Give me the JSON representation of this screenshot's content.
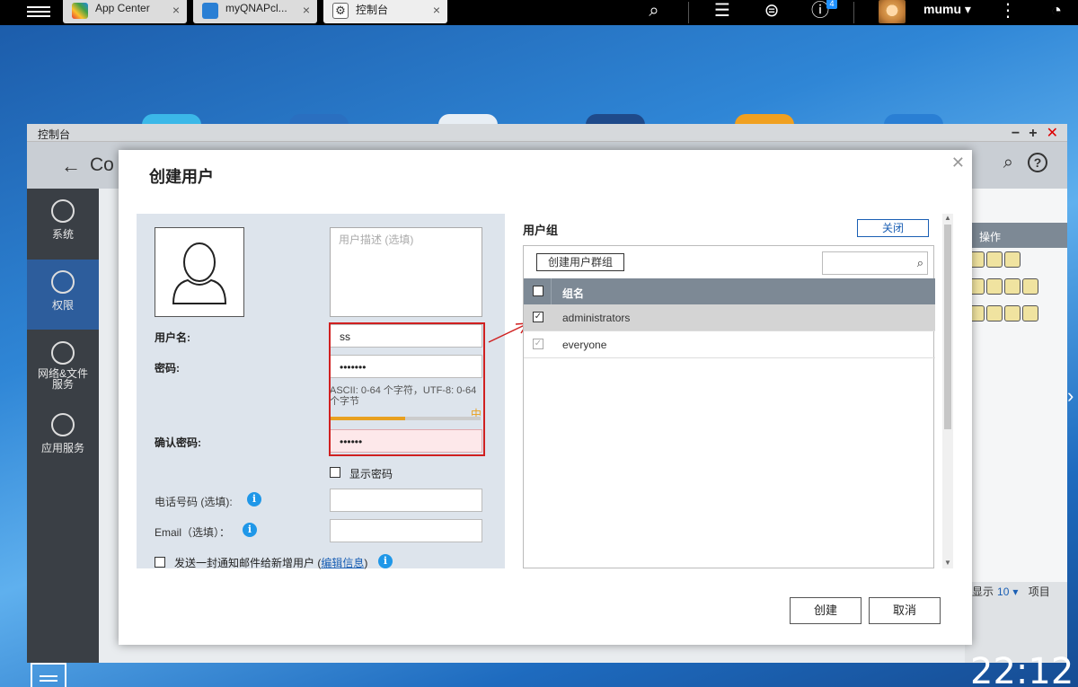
{
  "taskbar": {
    "tabs": [
      {
        "label": "App Center",
        "color": "#f0a020"
      },
      {
        "label": "myQNAPcl...",
        "color": "#2a7fd4"
      },
      {
        "label": "控制台",
        "color": "#888888"
      }
    ],
    "user_name": "mumu",
    "notification_count": "4"
  },
  "control_panel": {
    "title": "控制台",
    "heading": "Co",
    "sidebar": [
      {
        "label": "系统"
      },
      {
        "label": "权限"
      },
      {
        "label": "网络&文件服务"
      },
      {
        "label": "应用服务"
      }
    ],
    "table_header": "操作",
    "page_size_prefix": "显示",
    "page_size": "10",
    "page_size_suffix": "项目"
  },
  "dialog": {
    "title": "创建用户",
    "description_placeholder": "用户描述 (选填)",
    "username_label": "用户名:",
    "username_value": "ss",
    "password_label": "密码:",
    "password_value": "•••••••",
    "password_hint": "ASCII: 0-64 个字符，UTF-8: 0-64 个字节",
    "strength_label": "中",
    "strength_level": 0.5,
    "confirm_label": "确认密码:",
    "confirm_value": "••••••",
    "show_password_label": "显示密码",
    "phone_label": "电话号码 (选填):",
    "email_label": "Email（选填）：",
    "notify_label": "发送一封通知邮件给新增用户 (",
    "notify_link": "编辑信息",
    "notify_suffix": ")",
    "groups": {
      "title": "用户组",
      "close_label": "关闭",
      "create_group_label": "创建用户群组",
      "column_header": "组名",
      "rows": [
        {
          "name": "administrators",
          "checked": true
        },
        {
          "name": "everyone",
          "checked": true
        }
      ]
    },
    "create_label": "创建",
    "cancel_label": "取消"
  },
  "clock": "22:12"
}
